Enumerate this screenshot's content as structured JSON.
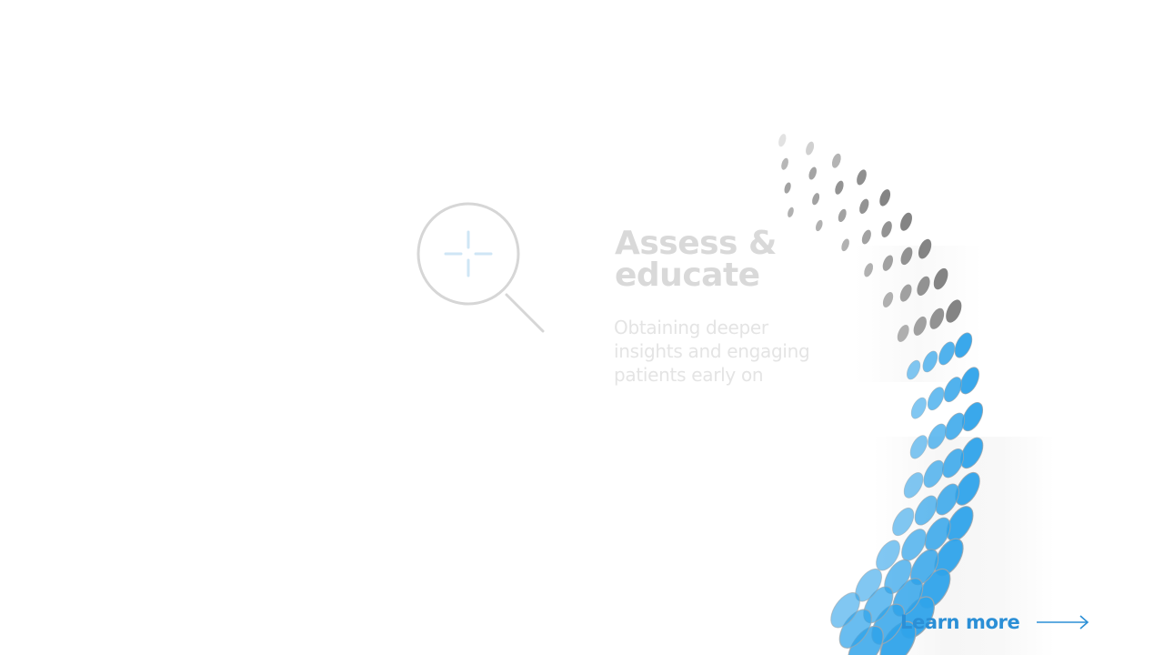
{
  "section": {
    "title_line1": "Assess &",
    "title_line2": "educate",
    "description_lines": [
      "Obtaining deeper",
      "insights and engaging",
      "patients early on"
    ]
  },
  "cta": {
    "label": "Learn more"
  },
  "icons": {
    "section_icon": "magnifier-icon",
    "cta_icon": "arrow-right-icon"
  },
  "colors": {
    "accent": "#2b8fd6",
    "dot_blue": "#2fa3ea",
    "dot_gray": "#6f6f6f",
    "title": "#d9d9d9",
    "subtext": "#e4e4e4"
  }
}
